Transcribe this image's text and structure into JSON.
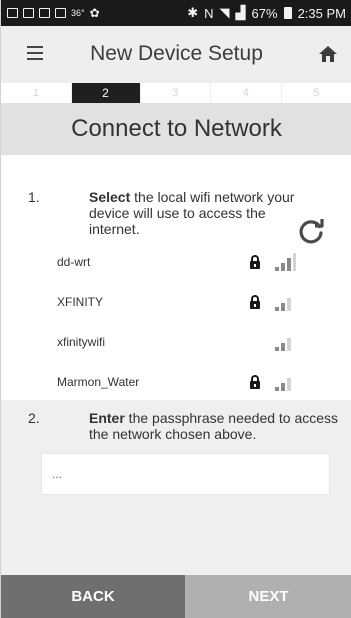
{
  "status_bar": {
    "temperature": "36°",
    "battery_percent": "67%",
    "time": "2:35 PM"
  },
  "header": {
    "title": "New Device Setup",
    "menu_icon": "hamburger-menu-icon",
    "home_icon": "home-icon"
  },
  "steps": [
    "1",
    "2",
    "3",
    "4",
    "5"
  ],
  "active_step": "2",
  "section_title": "Connect to Network",
  "step1": {
    "number": "1.",
    "bold": "Select",
    "text": " the local wifi network your device will use to access the internet."
  },
  "networks": [
    {
      "name": "dd-wrt",
      "locked": true,
      "signal_level": 3
    },
    {
      "name": "XFINITY",
      "locked": true,
      "signal_level": 2
    },
    {
      "name": "xfinitywifi",
      "locked": false,
      "signal_level": 2
    },
    {
      "name": "Marmon_Water",
      "locked": true,
      "signal_level": 2
    }
  ],
  "step2": {
    "number": "2.",
    "bold": "Enter",
    "text": " the passphrase needed to access the network chosen above."
  },
  "passphrase": {
    "value": "..."
  },
  "buttons": {
    "back": "BACK",
    "next": "NEXT"
  },
  "colors": {
    "back_button": "#6f6f6f",
    "next_button": "#b0b0b0",
    "active_step": "#1f1f1f"
  }
}
